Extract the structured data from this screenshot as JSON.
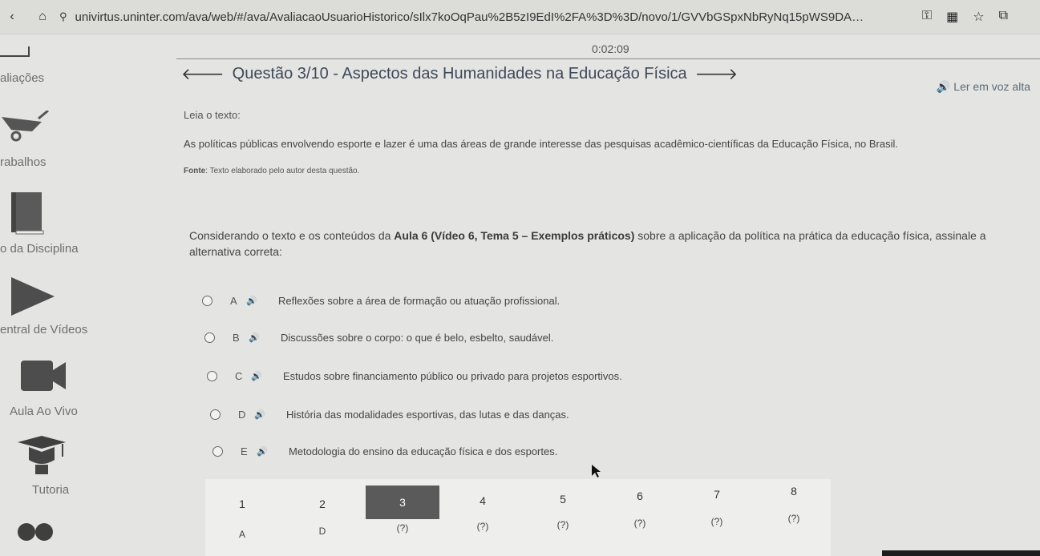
{
  "browser": {
    "url": "univirtus.uninter.com/ava/web/#/ava/AvaliacaoUsuarioHistorico/sIlx7koOqPau%2B5zI9EdI%2FA%3D%3D/novo/1/GVVbGSpxNbRyNq15pWS9DA%3D%..."
  },
  "timer": "0:02:09",
  "sidebar": {
    "items": [
      {
        "label": "aliações",
        "icon": "checklist-icon"
      },
      {
        "label": "rabalhos",
        "icon": "wheelbarrow-icon"
      },
      {
        "label": "o da Disciplina",
        "icon": "book-icon"
      },
      {
        "label": "entral de Vídeos",
        "icon": "play-icon"
      },
      {
        "label": "Aula Ao Vivo",
        "icon": "video-camera-icon"
      },
      {
        "label": "Tutoria",
        "icon": "graduation-cap-icon"
      }
    ]
  },
  "question": {
    "title": "Questão 3/10 - Aspectos das Humanidades na Educação Física",
    "tts_label": "Ler em voz alta",
    "leia": "Leia o texto:",
    "texto": "As políticas públicas envolvendo esporte e lazer é uma das áreas de grande interesse das pesquisas acadêmico-científicas da Educação Física, no Brasil.",
    "fonte_label": "Fonte",
    "fonte_text": ": Texto elaborado pelo autor desta questão.",
    "enunciado_pre": "Considerando o texto e os conteúdos da ",
    "enunciado_bold1": "Aula 6 (Vídeo 6, Tema 5 – Exemplos práticos)",
    "enunciado_post": " sobre a aplicação da política na prática da educação física, assinale a alternativa correta:",
    "alternatives": [
      {
        "letter": "A",
        "text": "Reflexões sobre a área de formação ou atuação profissional."
      },
      {
        "letter": "B",
        "text": "Discussões sobre o corpo: o que é belo, esbelto, saudável."
      },
      {
        "letter": "C",
        "text": "Estudos sobre financiamento público ou privado para projetos esportivos."
      },
      {
        "letter": "D",
        "text": "História das modalidades esportivas, das lutas e das danças."
      },
      {
        "letter": "E",
        "text": "Metodologia do ensino da educação física e dos esportes."
      }
    ]
  },
  "nav": {
    "numbers": [
      "1",
      "2",
      "3",
      "4",
      "5",
      "6",
      "7",
      "8"
    ],
    "answers": [
      "A",
      "D",
      "(?)",
      "(?)",
      "(?)",
      "(?)",
      "(?)",
      "(?)"
    ],
    "active_index": 2
  },
  "colors": {
    "background": "#e4e4e2",
    "active_cell": "#5a5a5a",
    "title": "#3e4a59"
  }
}
